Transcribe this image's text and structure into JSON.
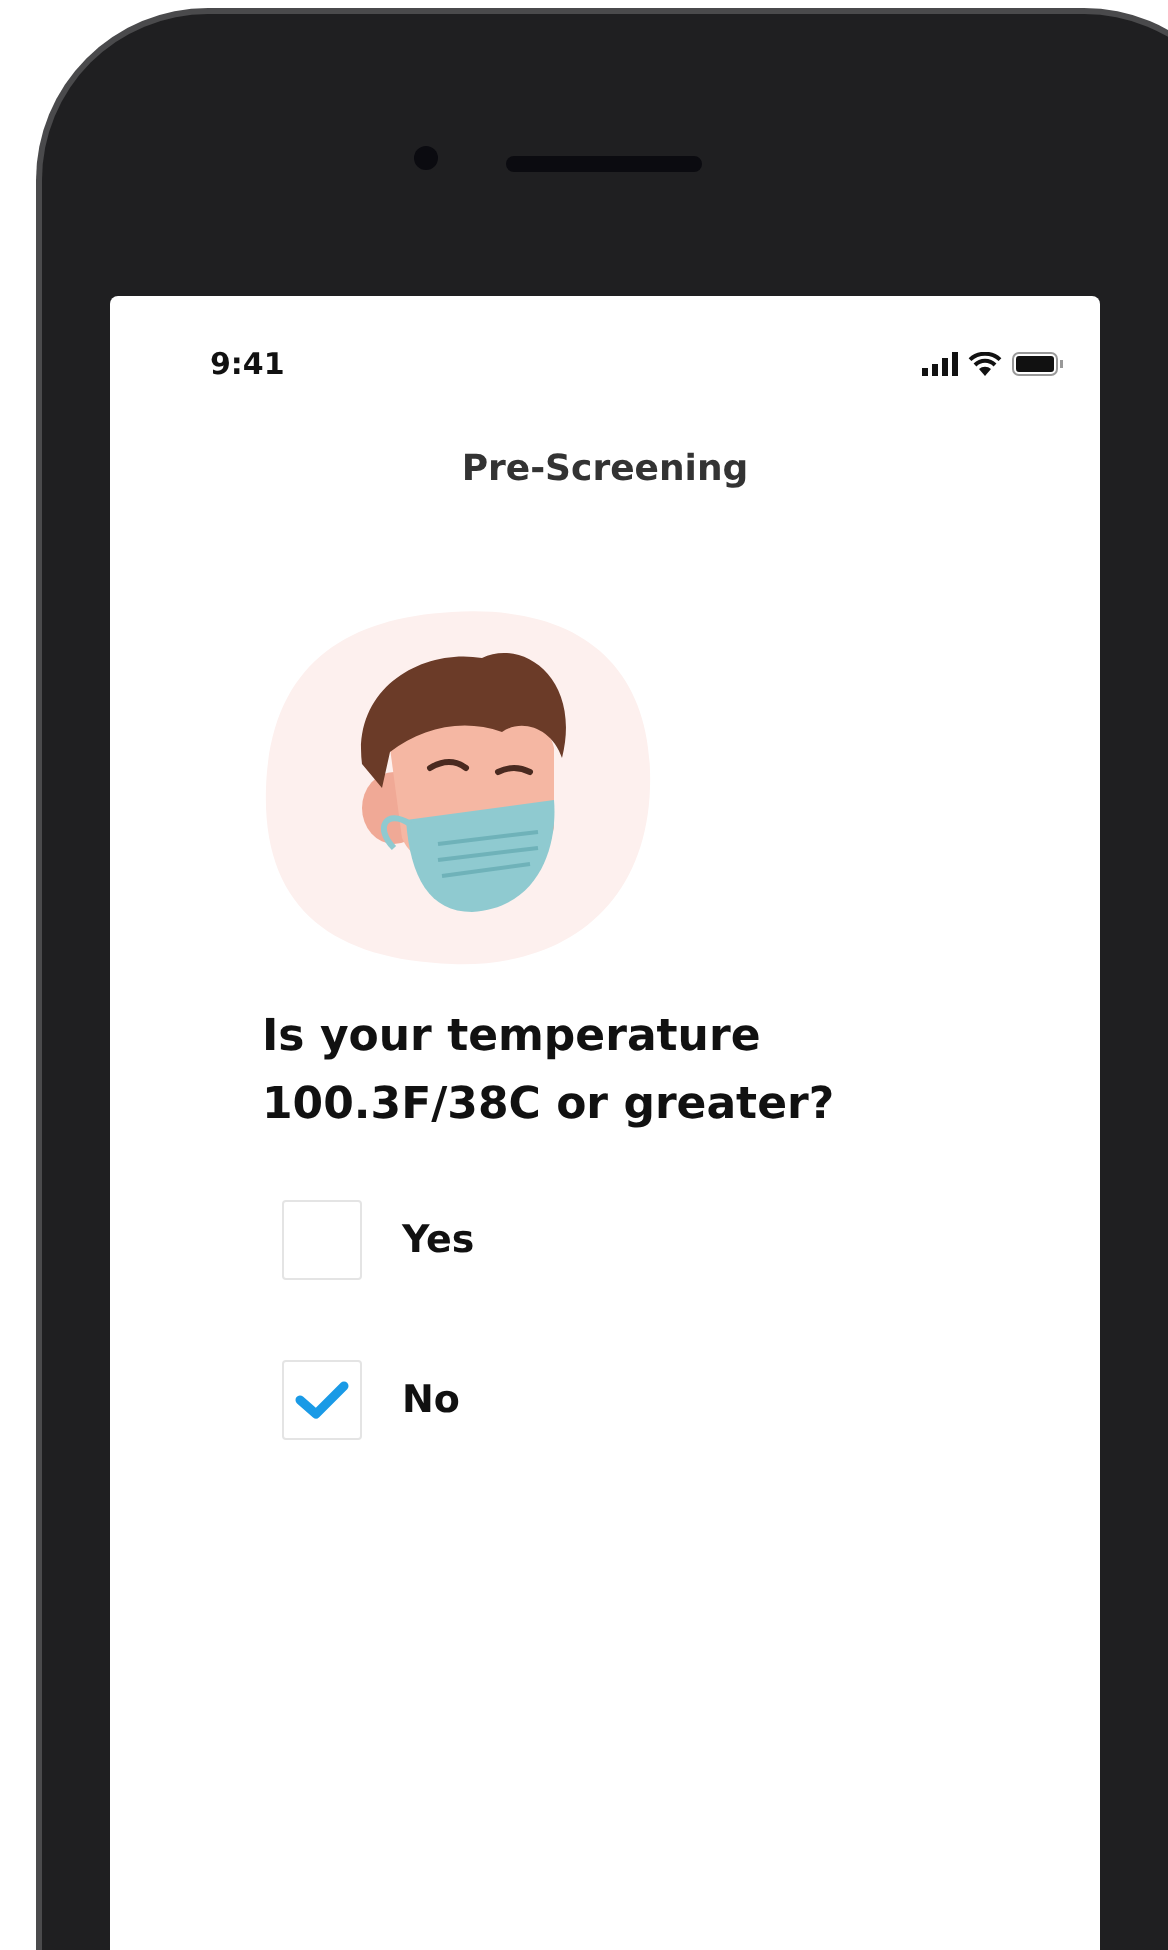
{
  "status_bar": {
    "time": "9:41"
  },
  "title": "Pre-Screening",
  "question": "Is your temperature 100.3F/38C or greater?",
  "options": [
    {
      "label": "Yes",
      "checked": false
    },
    {
      "label": "No",
      "checked": true
    }
  ]
}
